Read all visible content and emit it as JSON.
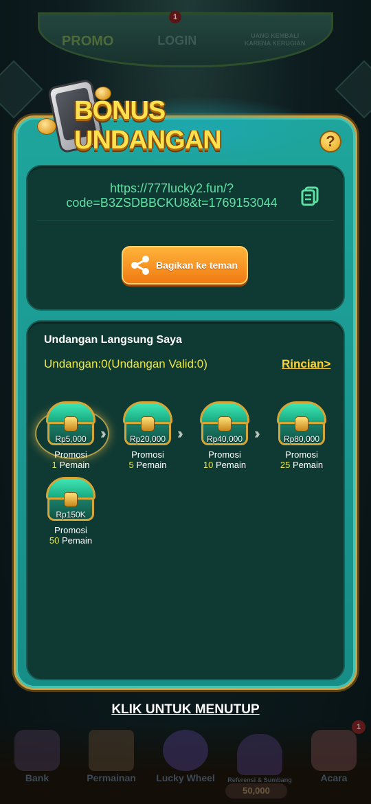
{
  "background": {
    "top_tabs": [
      "PROMO",
      "LOGIN",
      "UANG KEMBALI KARENA KERUGIAN"
    ],
    "top_badge": "1",
    "bottom_nav": [
      {
        "label": "Bank",
        "icon": "bank-icon"
      },
      {
        "label": "Permainan",
        "icon": "slot-777-icon"
      },
      {
        "label": "Lucky Wheel",
        "icon": "wheel-icon"
      },
      {
        "label": "Referensi & Sumbang",
        "icon": "referral-icon"
      },
      {
        "label": "Acara",
        "icon": "gift-icon",
        "badge": "1"
      }
    ],
    "balance": "50,000"
  },
  "modal": {
    "title": "BONUS UNDANGAN",
    "help_icon": "?",
    "invite_link": "https://777lucky2.fun/?code=B3ZSDBBCKU8&t=1769153044",
    "share_button": "Bagikan ke teman",
    "invites": {
      "title": "Undangan Langsung Saya",
      "count_text": "Undangan:0(Undangan Valid:0)",
      "details_link": "Rincian>",
      "rewards": [
        {
          "amount": "Rp5,000",
          "label": "Promosi",
          "count": "1",
          "unit": " Pemain"
        },
        {
          "amount": "Rp20,000",
          "label": "Promosi",
          "count": "5",
          "unit": " Pemain"
        },
        {
          "amount": "Rp40,000",
          "label": "Promosi",
          "count": "10",
          "unit": " Pemain"
        },
        {
          "amount": "Rp80,000",
          "label": "Promosi",
          "count": "25",
          "unit": " Pemain"
        },
        {
          "amount": "Rp150K",
          "label": "Promosi",
          "count": "50",
          "unit": " Pemain"
        }
      ]
    }
  },
  "close_label": "KLIK UNTUK MENUTUP",
  "colors": {
    "modal_teal": "#1ea59c",
    "panel_dark": "#0f3a33",
    "link_green": "#5fe0a3",
    "accent_yellow": "#e8e64a",
    "share_orange": "#f07a12"
  }
}
